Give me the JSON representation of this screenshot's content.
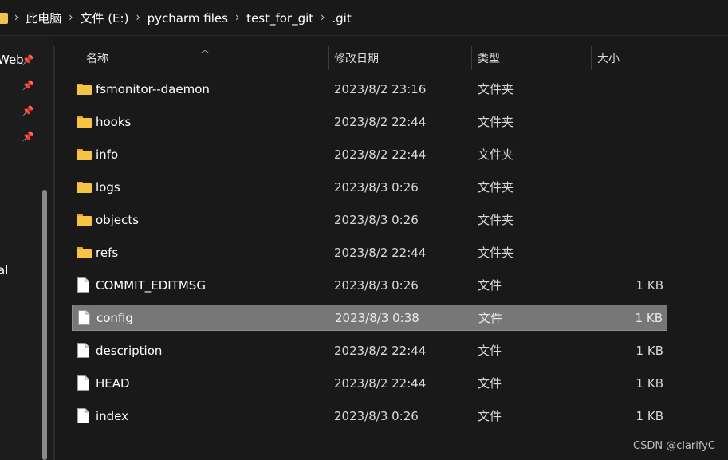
{
  "breadcrumb": {
    "items": [
      "此电脑",
      "文件 (E:)",
      "pycharm files",
      "test_for_git",
      ".git"
    ]
  },
  "nav": {
    "items": [
      {
        "label": "Web",
        "icon": "pin-icon"
      },
      {
        "label": "",
        "icon": "pin-icon"
      },
      {
        "label": "",
        "icon": "pin-icon"
      },
      {
        "label": "",
        "icon": "pin-icon"
      },
      {
        "label": "al",
        "icon": ""
      }
    ]
  },
  "columns": {
    "name": "名称",
    "date": "修改日期",
    "type": "类型",
    "size": "大小",
    "sort": "name-ascending"
  },
  "files": [
    {
      "name": "fsmonitor--daemon",
      "date": "2023/8/2 23:16",
      "type": "文件夹",
      "size": "",
      "kind": "folder",
      "selected": false
    },
    {
      "name": "hooks",
      "date": "2023/8/2 22:44",
      "type": "文件夹",
      "size": "",
      "kind": "folder",
      "selected": false
    },
    {
      "name": "info",
      "date": "2023/8/2 22:44",
      "type": "文件夹",
      "size": "",
      "kind": "folder",
      "selected": false
    },
    {
      "name": "logs",
      "date": "2023/8/3 0:26",
      "type": "文件夹",
      "size": "",
      "kind": "folder",
      "selected": false
    },
    {
      "name": "objects",
      "date": "2023/8/3 0:26",
      "type": "文件夹",
      "size": "",
      "kind": "folder",
      "selected": false
    },
    {
      "name": "refs",
      "date": "2023/8/2 22:44",
      "type": "文件夹",
      "size": "",
      "kind": "folder",
      "selected": false
    },
    {
      "name": "COMMIT_EDITMSG",
      "date": "2023/8/3 0:26",
      "type": "文件",
      "size": "1 KB",
      "kind": "file",
      "selected": false
    },
    {
      "name": "config",
      "date": "2023/8/3 0:38",
      "type": "文件",
      "size": "1 KB",
      "kind": "file",
      "selected": true
    },
    {
      "name": "description",
      "date": "2023/8/2 22:44",
      "type": "文件",
      "size": "1 KB",
      "kind": "file",
      "selected": false
    },
    {
      "name": "HEAD",
      "date": "2023/8/2 22:44",
      "type": "文件",
      "size": "1 KB",
      "kind": "file",
      "selected": false
    },
    {
      "name": "index",
      "date": "2023/8/3 0:26",
      "type": "文件",
      "size": "1 KB",
      "kind": "file",
      "selected": false
    }
  ],
  "watermark": "CSDN @clarifyC",
  "colors": {
    "background": "#191919",
    "selection": "#777777",
    "folder": "#f6c445"
  }
}
